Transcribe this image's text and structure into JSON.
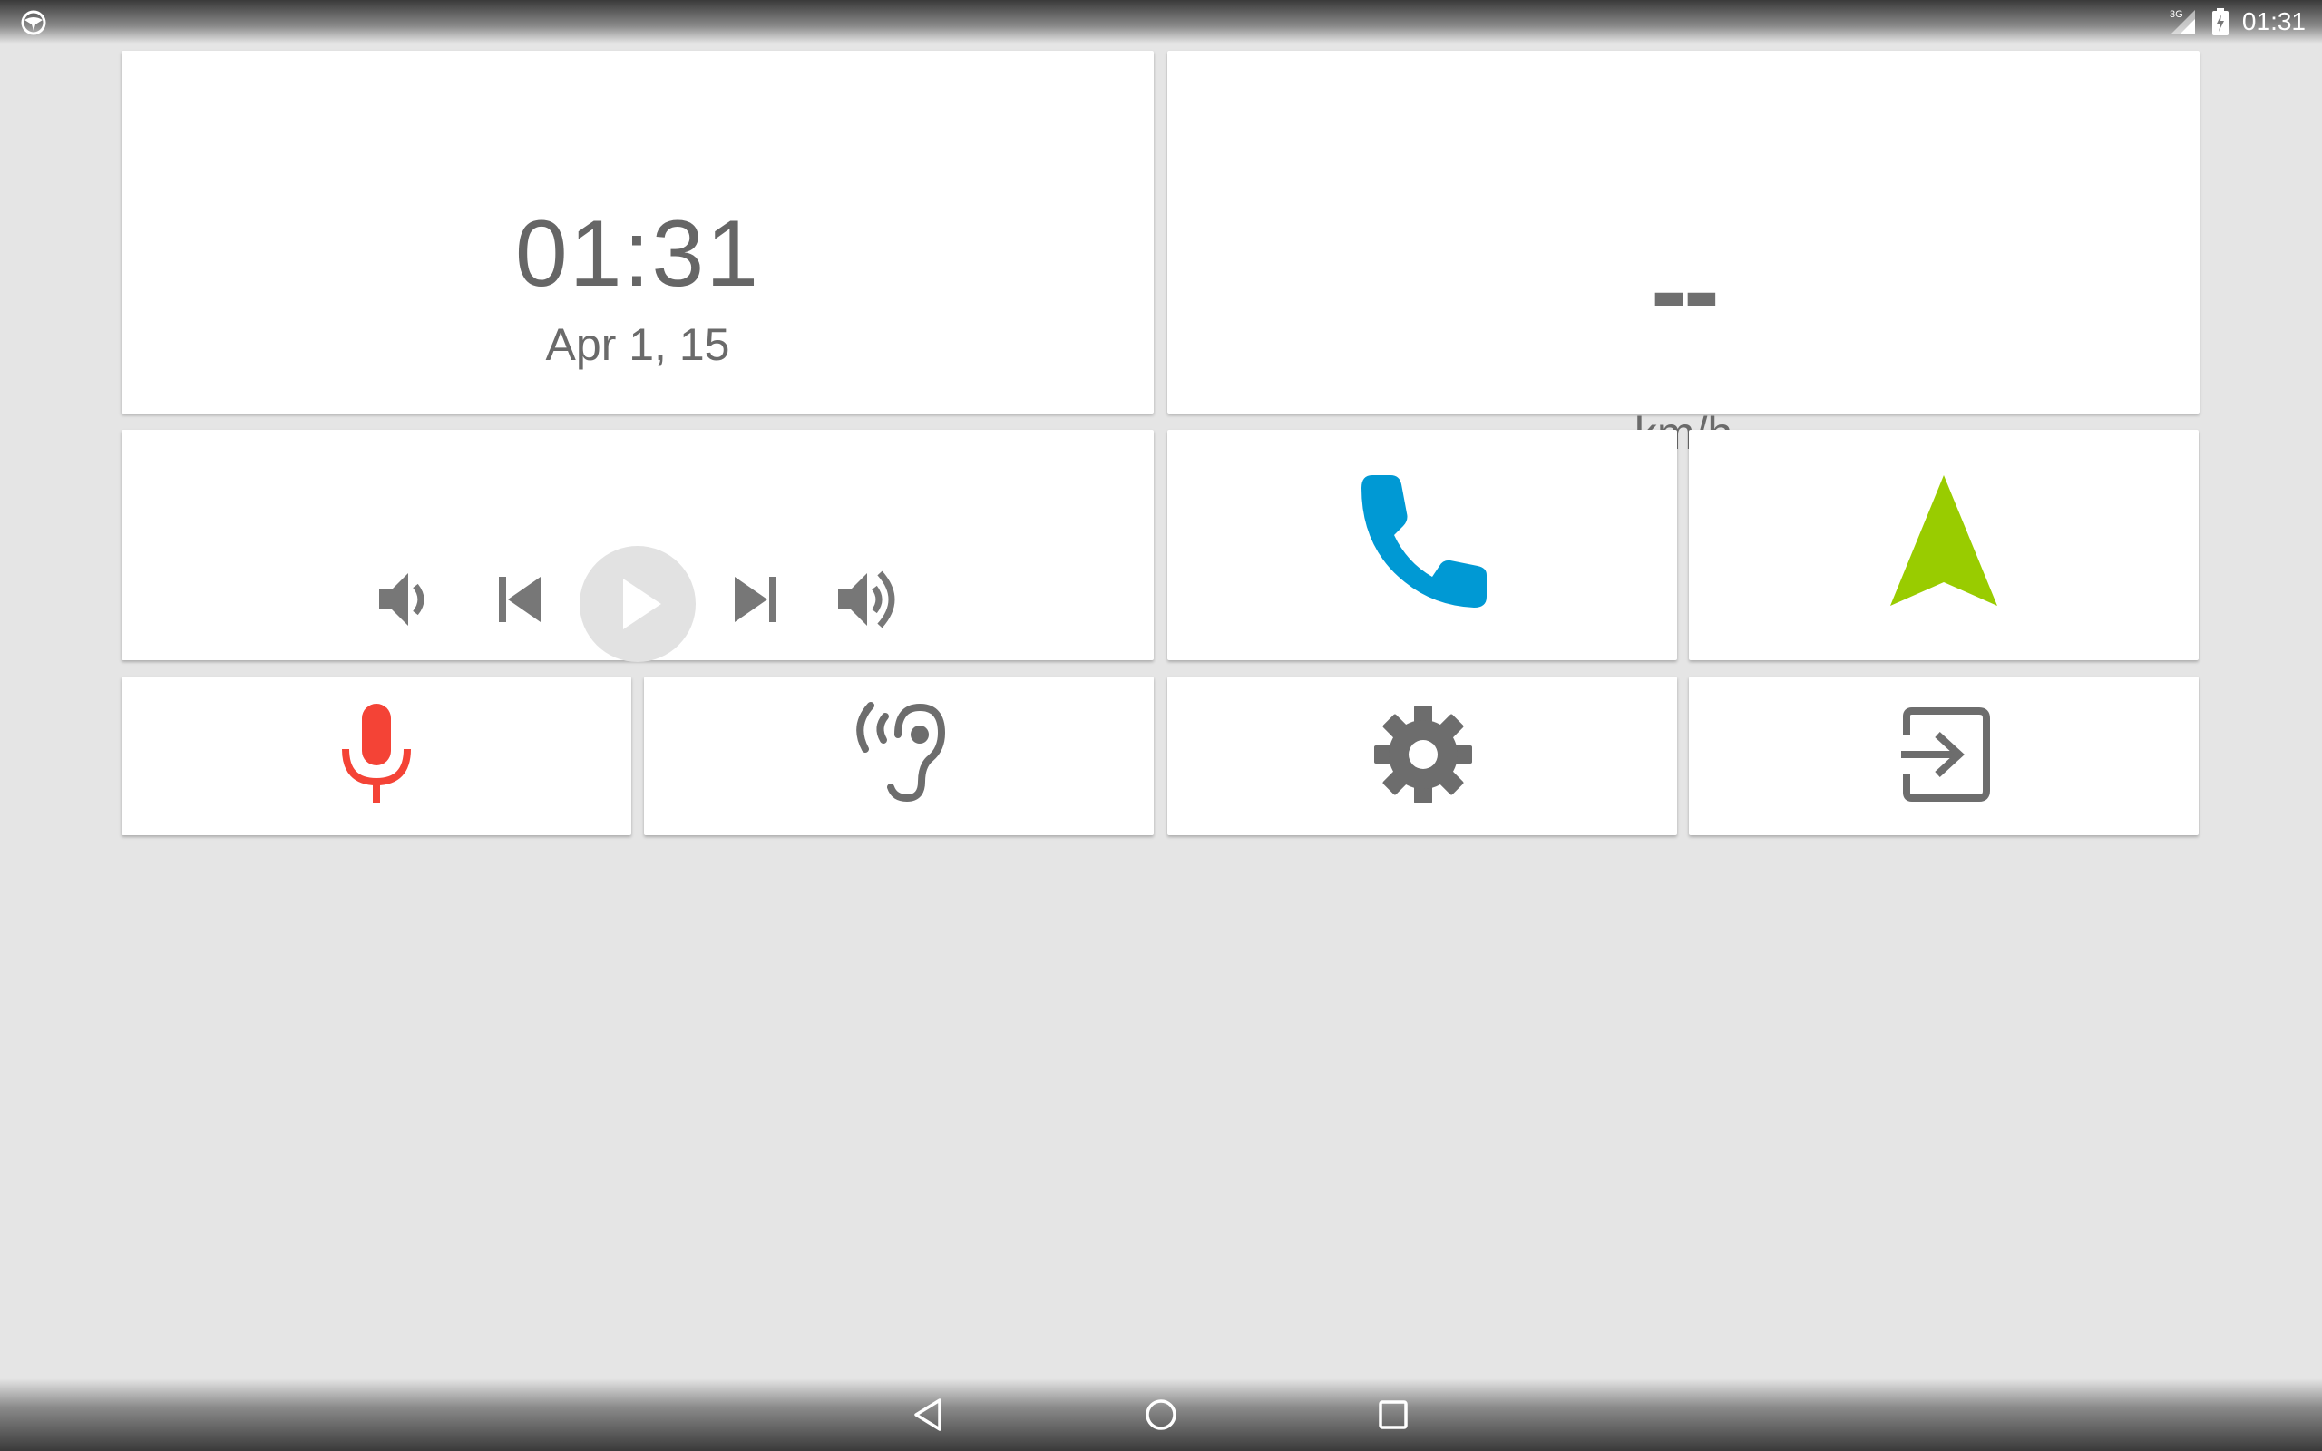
{
  "statusbar": {
    "left_icon": "steering-wheel-icon",
    "signal_label": "3G",
    "time": "01:31"
  },
  "clock": {
    "time": "01:31",
    "date": "Apr 1, 15"
  },
  "speed": {
    "value": "--",
    "unit": "km/h"
  },
  "media": {
    "controls": [
      "volume-down-icon",
      "skip-previous-icon",
      "play-icon",
      "skip-next-icon",
      "volume-up-icon"
    ]
  },
  "tiles": {
    "phone": {
      "icon": "phone-icon",
      "color": "#0099d4"
    },
    "navigation": {
      "icon": "navigation-arrow-icon",
      "color": "#99cc00"
    },
    "voice": {
      "icon": "microphone-icon",
      "color": "#f44336"
    },
    "hearing": {
      "icon": "ear-listening-icon",
      "color": "#6d6d6d"
    },
    "settings": {
      "icon": "gear-icon",
      "color": "#6d6d6d"
    },
    "exit": {
      "icon": "exit-icon",
      "color": "#6d6d6d"
    }
  },
  "navbar": {
    "buttons": [
      "back-icon",
      "home-icon",
      "recents-icon"
    ]
  }
}
